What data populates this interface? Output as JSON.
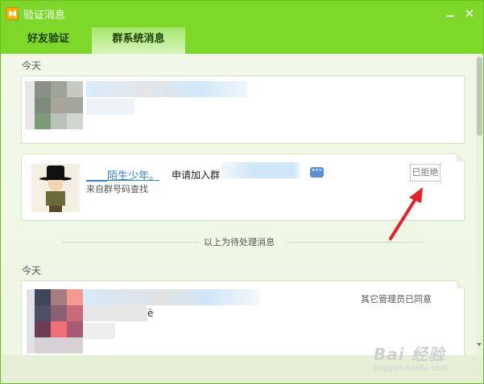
{
  "window": {
    "title": "验证消息",
    "minimize_label": "",
    "close_label": "✕"
  },
  "tabs": [
    {
      "label": "好友验证",
      "active": false
    },
    {
      "label": "群系统消息",
      "active": true
    }
  ],
  "pending_section": {
    "date_label": "今天",
    "items": [
      {
        "username": "陌生少年。",
        "username_prefix": "____",
        "action": "申请加入群",
        "source": "来自群号码查找",
        "status": "已拒绝"
      }
    ]
  },
  "divider": {
    "label": "以上为待处理消息"
  },
  "processed_section": {
    "date_label": "今天",
    "items": [
      {
        "status": "其它管理员已同意",
        "extra_text": "è"
      }
    ]
  },
  "watermark": {
    "logo": "Bai 经验",
    "url": "jingyan.baidu.com"
  },
  "colors": {
    "title_bar": "#7dd82a",
    "link": "#2b7fd4",
    "arrow": "#e8202a"
  }
}
